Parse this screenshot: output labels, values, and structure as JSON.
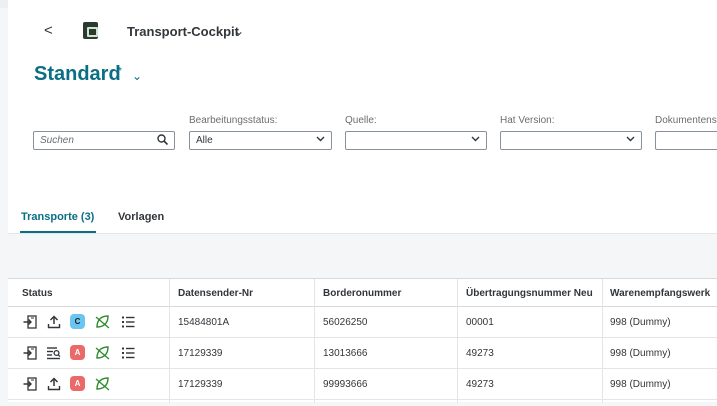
{
  "app": {
    "title": "Transport-Cockpit",
    "back_glyph": "<",
    "chevron_glyph": "⌄"
  },
  "variant": {
    "name": "Standard",
    "modified_marker": "*",
    "chevron_glyph": "⌄"
  },
  "filters": {
    "search_placeholder": "Suchen",
    "bearbeitungsstatus": {
      "label": "Bearbeitungsstatus:",
      "value": "Alle"
    },
    "quelle": {
      "label": "Quelle:",
      "value": ""
    },
    "hat_version": {
      "label": "Hat Version:",
      "value": ""
    },
    "dokumentens": {
      "label": "Dokumentens",
      "value": ""
    }
  },
  "tabs": [
    {
      "label": "Transporte (3)",
      "active": true
    },
    {
      "label": "Vorlagen",
      "active": false
    }
  ],
  "table": {
    "columns": [
      "Status",
      "Datensender-Nr",
      "Borderonummer",
      "Übertragungsnummer Neu",
      "Warenempfangswerk"
    ],
    "rows": [
      {
        "icons": [
          "import-icon",
          "upload-icon",
          "badge-c",
          "leaf-icon",
          "list-icon"
        ],
        "badge": "C",
        "datensender": "15484801A",
        "borderonummer": "56026250",
        "uebertragungsnummer": "00001",
        "warenempfangswerk": "998 (Dummy)"
      },
      {
        "icons": [
          "import-icon",
          "document-search-icon",
          "badge-a",
          "leaf-icon",
          "list-icon"
        ],
        "badge": "A",
        "datensender": "17129339",
        "borderonummer": "13013666",
        "uebertragungsnummer": "49273",
        "warenempfangswerk": "998 (Dummy)"
      },
      {
        "icons": [
          "import-icon",
          "upload-icon",
          "badge-a",
          "leaf-icon"
        ],
        "badge": "A",
        "datensender": "17129339",
        "borderonummer": "99993666",
        "uebertragungsnummer": "49273",
        "warenempfangswerk": "998 (Dummy)"
      }
    ]
  },
  "colors": {
    "accent": "#0a6e84",
    "badge_c": "#6ac6f0",
    "badge_a": "#ea6a6a",
    "leaf_green": "#2e8b2e"
  }
}
